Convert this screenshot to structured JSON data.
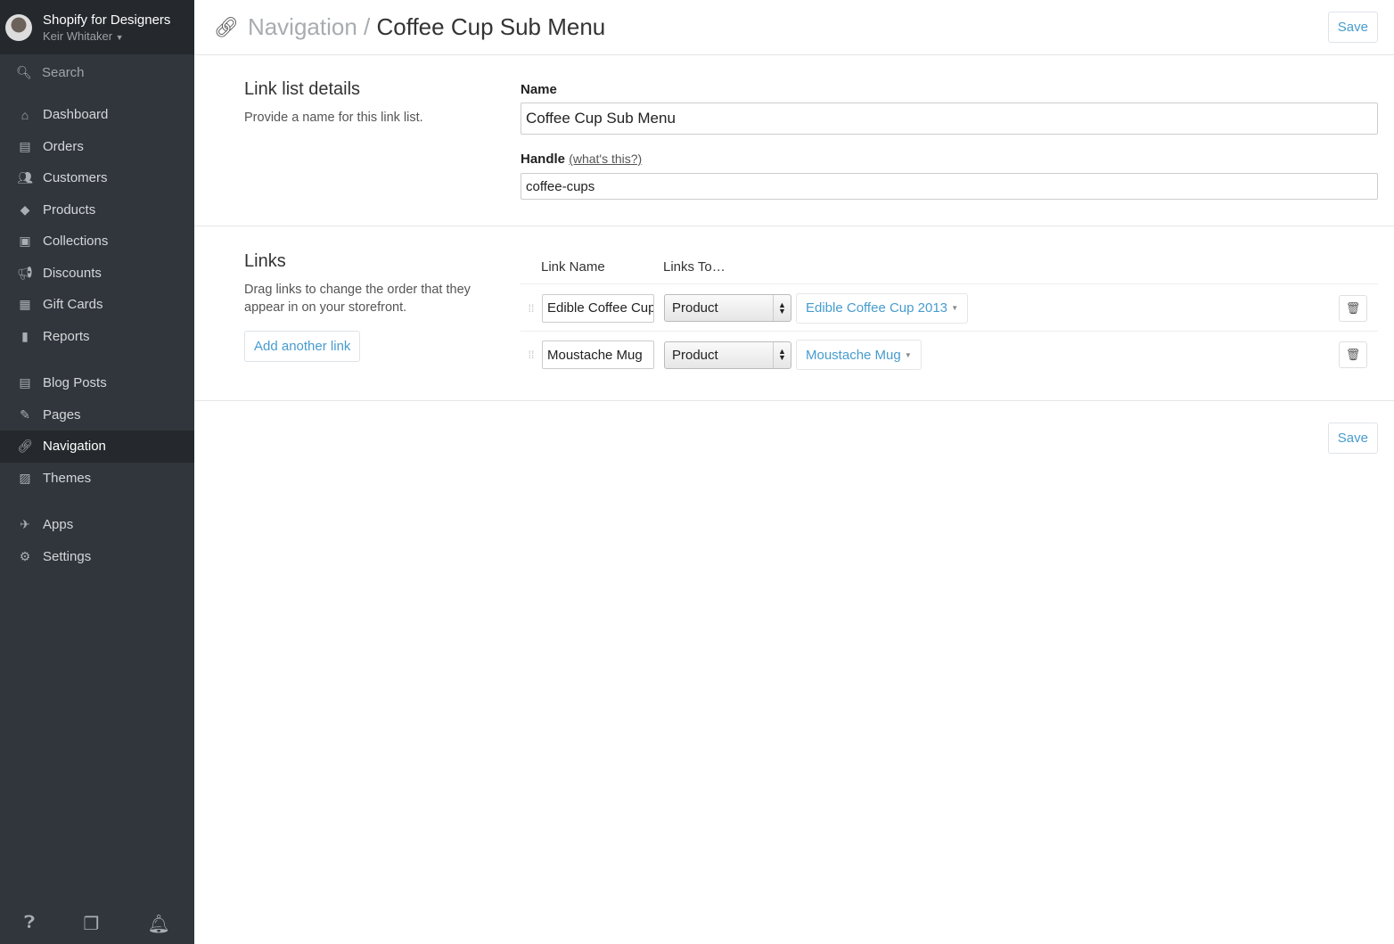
{
  "sidebar": {
    "shop_name": "Shopify for Designers",
    "user": "Keir Whitaker",
    "search": "Search",
    "items": [
      {
        "label": "Dashboard",
        "icon": "home-icon"
      },
      {
        "label": "Orders",
        "icon": "inbox-icon"
      },
      {
        "label": "Customers",
        "icon": "users-icon"
      },
      {
        "label": "Products",
        "icon": "tag-icon"
      },
      {
        "label": "Collections",
        "icon": "box-icon"
      },
      {
        "label": "Discounts",
        "icon": "megaphone-icon"
      },
      {
        "label": "Gift Cards",
        "icon": "gift-icon"
      },
      {
        "label": "Reports",
        "icon": "bar-chart-icon"
      },
      {
        "label": "Blog Posts",
        "icon": "newspaper-icon"
      },
      {
        "label": "Pages",
        "icon": "edit-icon"
      },
      {
        "label": "Navigation",
        "icon": "link-icon"
      },
      {
        "label": "Themes",
        "icon": "image-icon"
      },
      {
        "label": "Apps",
        "icon": "apps-icon"
      },
      {
        "label": "Settings",
        "icon": "gear-icon"
      }
    ],
    "active": "Navigation"
  },
  "header": {
    "crumb": "Navigation",
    "sep": " / ",
    "title": "Coffee Cup Sub Menu",
    "save": "Save"
  },
  "details": {
    "heading": "Link list details",
    "desc": "Provide a name for this link list.",
    "name_label": "Name",
    "name_value": "Coffee Cup Sub Menu",
    "handle_label": "Handle",
    "handle_help": "(what's this?)",
    "handle_value": "coffee-cups"
  },
  "links": {
    "heading": "Links",
    "desc": "Drag links to change the order that they appear in on your storefront.",
    "add": "Add another link",
    "col_name": "Link Name",
    "col_to": "Links To…",
    "rows": [
      {
        "name": "Edible Coffee Cup",
        "type": "Product",
        "target": "Edible Coffee Cup 2013"
      },
      {
        "name": "Moustache Mug",
        "type": "Product",
        "target": "Moustache Mug"
      }
    ]
  },
  "footer": {
    "save": "Save"
  },
  "colors": {
    "accent": "#479ccf",
    "sidebar": "#30363c"
  }
}
